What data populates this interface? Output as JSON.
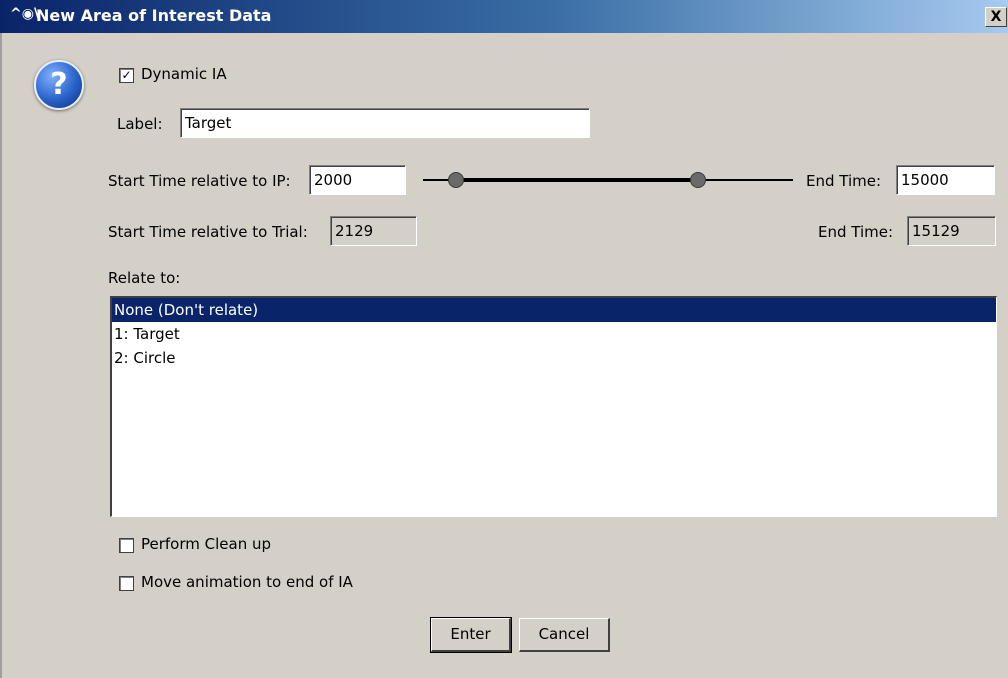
{
  "window": {
    "title": "New Area of Interest Data",
    "title_icon": "eye-icon",
    "close_label": "X"
  },
  "dialog": {
    "help_icon": "question-icon",
    "help_symbol": "?",
    "dynamic_ia": {
      "label": "Dynamic IA",
      "checked": true,
      "mark": "✓"
    },
    "label_field": {
      "label": "Label:",
      "value": "Target"
    },
    "ip_times": {
      "start_label": "Start Time relative to IP:",
      "start_value": "2000",
      "end_label": "End Time:",
      "end_value": "15000"
    },
    "trial_times": {
      "start_label": "Start Time relative to Trial:",
      "start_value": "2129",
      "end_label": "End Time:",
      "end_value": "15129"
    },
    "relate_to": {
      "label": "Relate to:",
      "items": [
        "None (Don't relate)",
        "1: Target",
        "2: Circle"
      ],
      "selected_index": 0
    },
    "perform_cleanup": {
      "label": "Perform Clean up",
      "checked": false
    },
    "move_animation": {
      "label": "Move animation to end of IA",
      "checked": false
    },
    "buttons": {
      "enter": "Enter",
      "cancel": "Cancel"
    }
  }
}
